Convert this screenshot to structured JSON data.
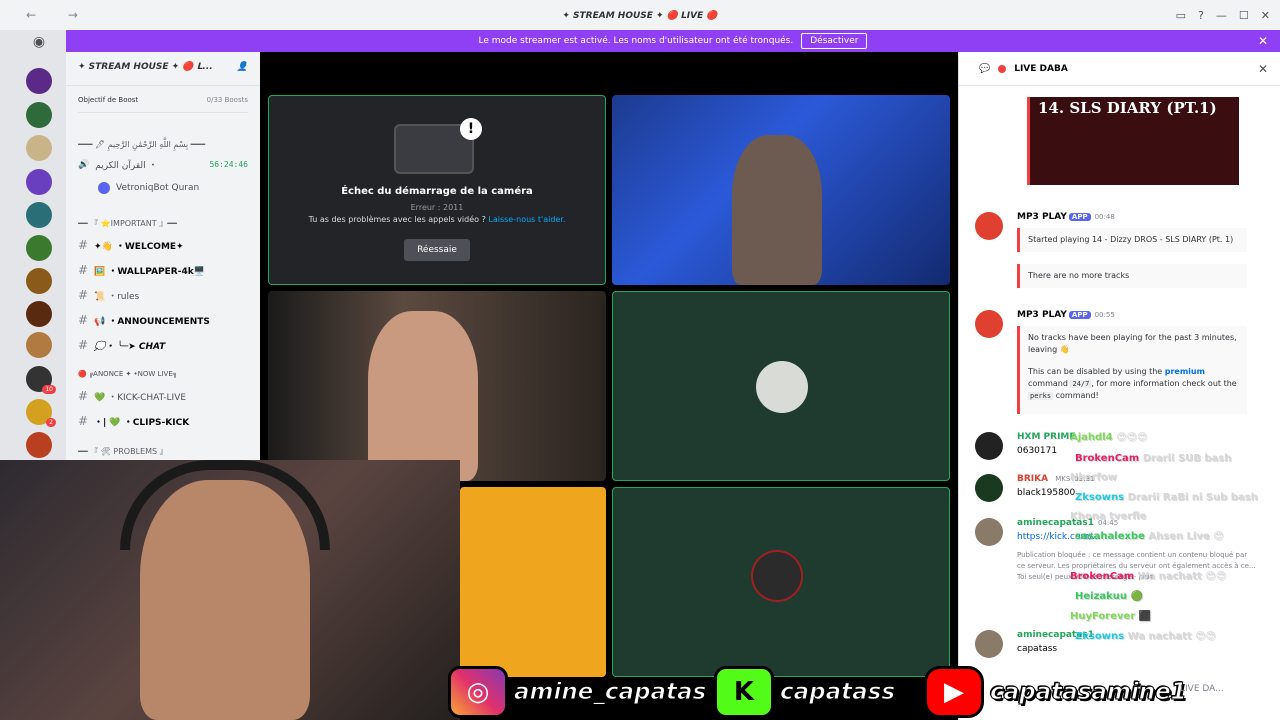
{
  "window": {
    "title": "✦ STREAM HOUSE ✦ 🔴 LIVE 🔴",
    "nav": "← →"
  },
  "banner": {
    "text": "Le mode streamer est activé. Les noms d'utilisateur ont été tronqués.",
    "button": "Désactiver"
  },
  "guild": {
    "name": "✦ STREAM HOUSE ✦ 🔴 𝗟...",
    "boost_label": "Objectif de Boost",
    "boost_count": "0/33 Boosts"
  },
  "channels": [
    {
      "label": "━━━ 🖊 بِسْمِ اللَّهِ الرَّحْمَٰنِ الرَّحِيمِ ━━━",
      "type": "category"
    },
    {
      "label": "القرآن الكريم ・",
      "type": "voice",
      "time": "56:24:46"
    },
    {
      "label": "VetroniqBot Quran",
      "type": "voice-user"
    },
    {
      "label": "━━ 『 ⭐IMPORTANT 』━━",
      "type": "category"
    },
    {
      "label": "✦👋 ・WELCOME✦",
      "type": "text"
    },
    {
      "label": "🖼️ ・WALLPAPER-4k🖥️",
      "type": "text"
    },
    {
      "label": "📜 ・rules",
      "type": "text"
    },
    {
      "label": "📢 ・ANNOUNCEMENTS",
      "type": "text"
    },
    {
      "label": "💭・ ╰─➤ CHAT",
      "type": "text"
    },
    {
      "label": "🔴 ╔ANONCE ✦ •NOW LIVE╗",
      "type": "text"
    },
    {
      "label": "💚 ・KICK-CHAT-LIVE",
      "type": "text"
    },
    {
      "label": "・| 💚 ・CLIPS-KICK",
      "type": "text"
    },
    {
      "label": "━━ 『 🛠 PROBLEMS 』",
      "type": "category"
    }
  ],
  "stage": {
    "camera_error_title": "Échec du démarrage de la caméra",
    "camera_error_code": "Erreur : 2011",
    "camera_error_help": "Tu as des problèmes avec les appels vidéo ?",
    "camera_error_link": "Laisse-nous t'aider.",
    "retry_button": "Réessaie"
  },
  "panel": {
    "title": "LIVE DABA",
    "embed_image_text": "14. SLS DIARY (PT.1)"
  },
  "messages": [
    {
      "author": "MP3 PLAY",
      "badge": "APP",
      "time": "00:48",
      "embed1": "Started playing 14 - Dizzy DROS - SLS DIARY (Pt. 1)",
      "embed2": "There are no more tracks"
    },
    {
      "author": "MP3 PLAY",
      "badge": "APP",
      "time": "00:55",
      "embed_a": "No tracks have been playing for the past 3 minutes, leaving 👋",
      "embed_b1": "This can be disabled by using the",
      "embed_b_link": "premium",
      "embed_b2": "command",
      "code1": "24/7",
      "embed_b3": ", for more information check out the",
      "code2": "perks",
      "embed_b4": "command!"
    },
    {
      "author": "HXM PRIME",
      "time": "",
      "text": "0630171"
    },
    {
      "author": "BRIKA",
      "badge": "MKS",
      "time": "02:31",
      "text": "black195800"
    },
    {
      "author": "aminecapatas1",
      "time": "04:45",
      "text": "https://kick.com/..."
    },
    {
      "author": "aminecapatas1",
      "time": "",
      "text": "capatass"
    }
  ],
  "blocked": {
    "text": "Publication bloquée : ce message contient un contenu bloqué par ce serveur. Les propriétaires du serveur ont également accès à ce...",
    "note": "Toi seul(e) peux voir ce message",
    "more": "plus"
  },
  "overlay_chat": [
    {
      "name": "Ajahdl4",
      "text": "😍😍😍",
      "color": "#7ed957"
    },
    {
      "name": "BrokenCam",
      "text": "Drarii SUB bash",
      "color": "#e91e63"
    },
    {
      "name": "",
      "text": "Nkerfow",
      "color": "#f0f0f0"
    },
    {
      "name": "Zksowns",
      "text": "Drarii RaBi ni Sub bash",
      "color": "#1ecbe1"
    },
    {
      "name": "",
      "text": "Khona tverfle",
      "color": "#f0f0f0"
    },
    {
      "name": "sasahalexbe",
      "text": "Ahsen Live 😍",
      "color": "#36c95b"
    },
    {
      "name": "BrokenCam",
      "text": "Wa nachatt 😍😍",
      "color": "#e91e63"
    },
    {
      "name": "Heizakuu",
      "text": "🟢",
      "color": "#36c95b"
    },
    {
      "name": "HuyForever",
      "text": "⬛",
      "color": "#7ed957"
    },
    {
      "name": "Zksowns",
      "text": "Wa nachatt 😍😍",
      "color": "#1ecbe1"
    }
  ],
  "socials": {
    "instagram": "amine_capatas",
    "kick": "capatass",
    "youtube": "capatasamine1"
  },
  "composer_placeholder": "LIVE DA...",
  "colors": {
    "accent": "#8f3ff4",
    "online": "#23a55a",
    "live": "#f23f43",
    "kick": "#53fc18",
    "youtube": "#ff0000"
  }
}
